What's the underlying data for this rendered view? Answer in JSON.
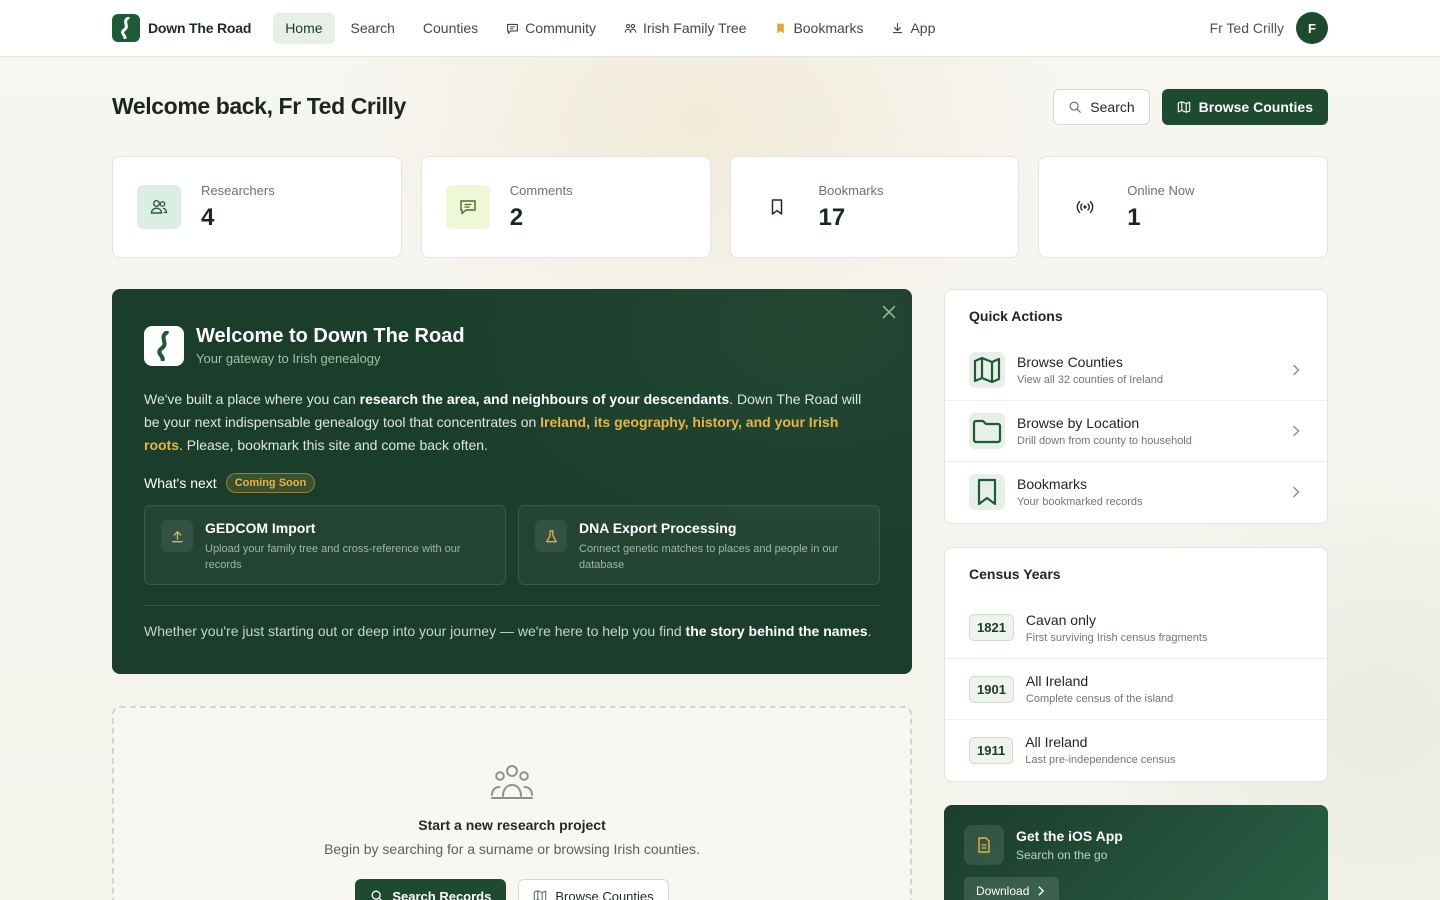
{
  "brand": {
    "name": "Down The Road"
  },
  "nav": {
    "items": [
      {
        "label": "Home",
        "icon": "",
        "active": true
      },
      {
        "label": "Search",
        "icon": ""
      },
      {
        "label": "Counties",
        "icon": ""
      },
      {
        "label": "Community",
        "icon": "chat-icon"
      },
      {
        "label": "Irish Family Tree",
        "icon": "family-tree-icon"
      },
      {
        "label": "Bookmarks",
        "icon": "bookmark-icon"
      },
      {
        "label": "App",
        "icon": "download-icon"
      }
    ],
    "user_name": "Fr Ted Crilly",
    "avatar_initial": "F"
  },
  "header": {
    "title": "Welcome back, Fr Ted Crilly",
    "search_label": "Search",
    "browse_label": "Browse Counties"
  },
  "stats": [
    {
      "label": "Researchers",
      "value": "4",
      "icon": "users-icon",
      "color": "#dbeee4"
    },
    {
      "label": "Comments",
      "value": "2",
      "icon": "comment-icon",
      "color": "#eef7d8"
    },
    {
      "label": "Bookmarks",
      "value": "17",
      "icon": "bookmark-icon",
      "color": "#ffffff"
    },
    {
      "label": "Online Now",
      "value": "1",
      "icon": "broadcast-icon",
      "color": "#ffffff"
    }
  ],
  "welcome": {
    "title": "Welcome to Down The Road",
    "subtitle": "Your gateway to Irish genealogy",
    "text_1": "We've built a place where you can ",
    "text_bold": "research the area, and neighbours of your descendants",
    "text_2": ". Down The Road will be your next indispensable genealogy tool that concentrates on ",
    "text_gold": "Ireland, its geography, history, and your Irish roots",
    "text_3": ". Please, bookmark this site and come back often.",
    "next_label": "What's next",
    "badge": "Coming Soon",
    "features": [
      {
        "title": "GEDCOM Import",
        "desc": "Upload your family tree and cross-reference with our records"
      },
      {
        "title": "DNA Export Processing",
        "desc": "Connect genetic matches to places and people in our database"
      }
    ],
    "footer_1": "Whether you're just starting out or deep into your journey — we're here to help you find ",
    "footer_bold": "the story behind the names",
    "footer_2": "."
  },
  "empty": {
    "title": "Start a new research project",
    "desc": "Begin by searching for a surname or browsing Irish counties.",
    "primary": "Search Records",
    "secondary": "Browse Counties"
  },
  "quick_actions": {
    "title": "Quick Actions",
    "items": [
      {
        "title": "Browse Counties",
        "desc": "View all 32 counties of Ireland",
        "icon": "map-icon"
      },
      {
        "title": "Browse by Location",
        "desc": "Drill down from county to household",
        "icon": "folder-icon"
      },
      {
        "title": "Bookmarks",
        "desc": "Your bookmarked records",
        "icon": "bookmark-icon"
      }
    ]
  },
  "census": {
    "title": "Census Years",
    "items": [
      {
        "year": "1821",
        "title": "Cavan only",
        "desc": "First surviving Irish census fragments"
      },
      {
        "year": "1901",
        "title": "All Ireland",
        "desc": "Complete census of the island"
      },
      {
        "year": "1911",
        "title": "All Ireland",
        "desc": "Last pre-independence census"
      }
    ]
  },
  "app_promo": {
    "title": "Get the iOS App",
    "subtitle": "Search on the go",
    "button": "Download"
  },
  "colors": {
    "primary": "#1e4a30",
    "accent_gold": "#e7b640"
  }
}
